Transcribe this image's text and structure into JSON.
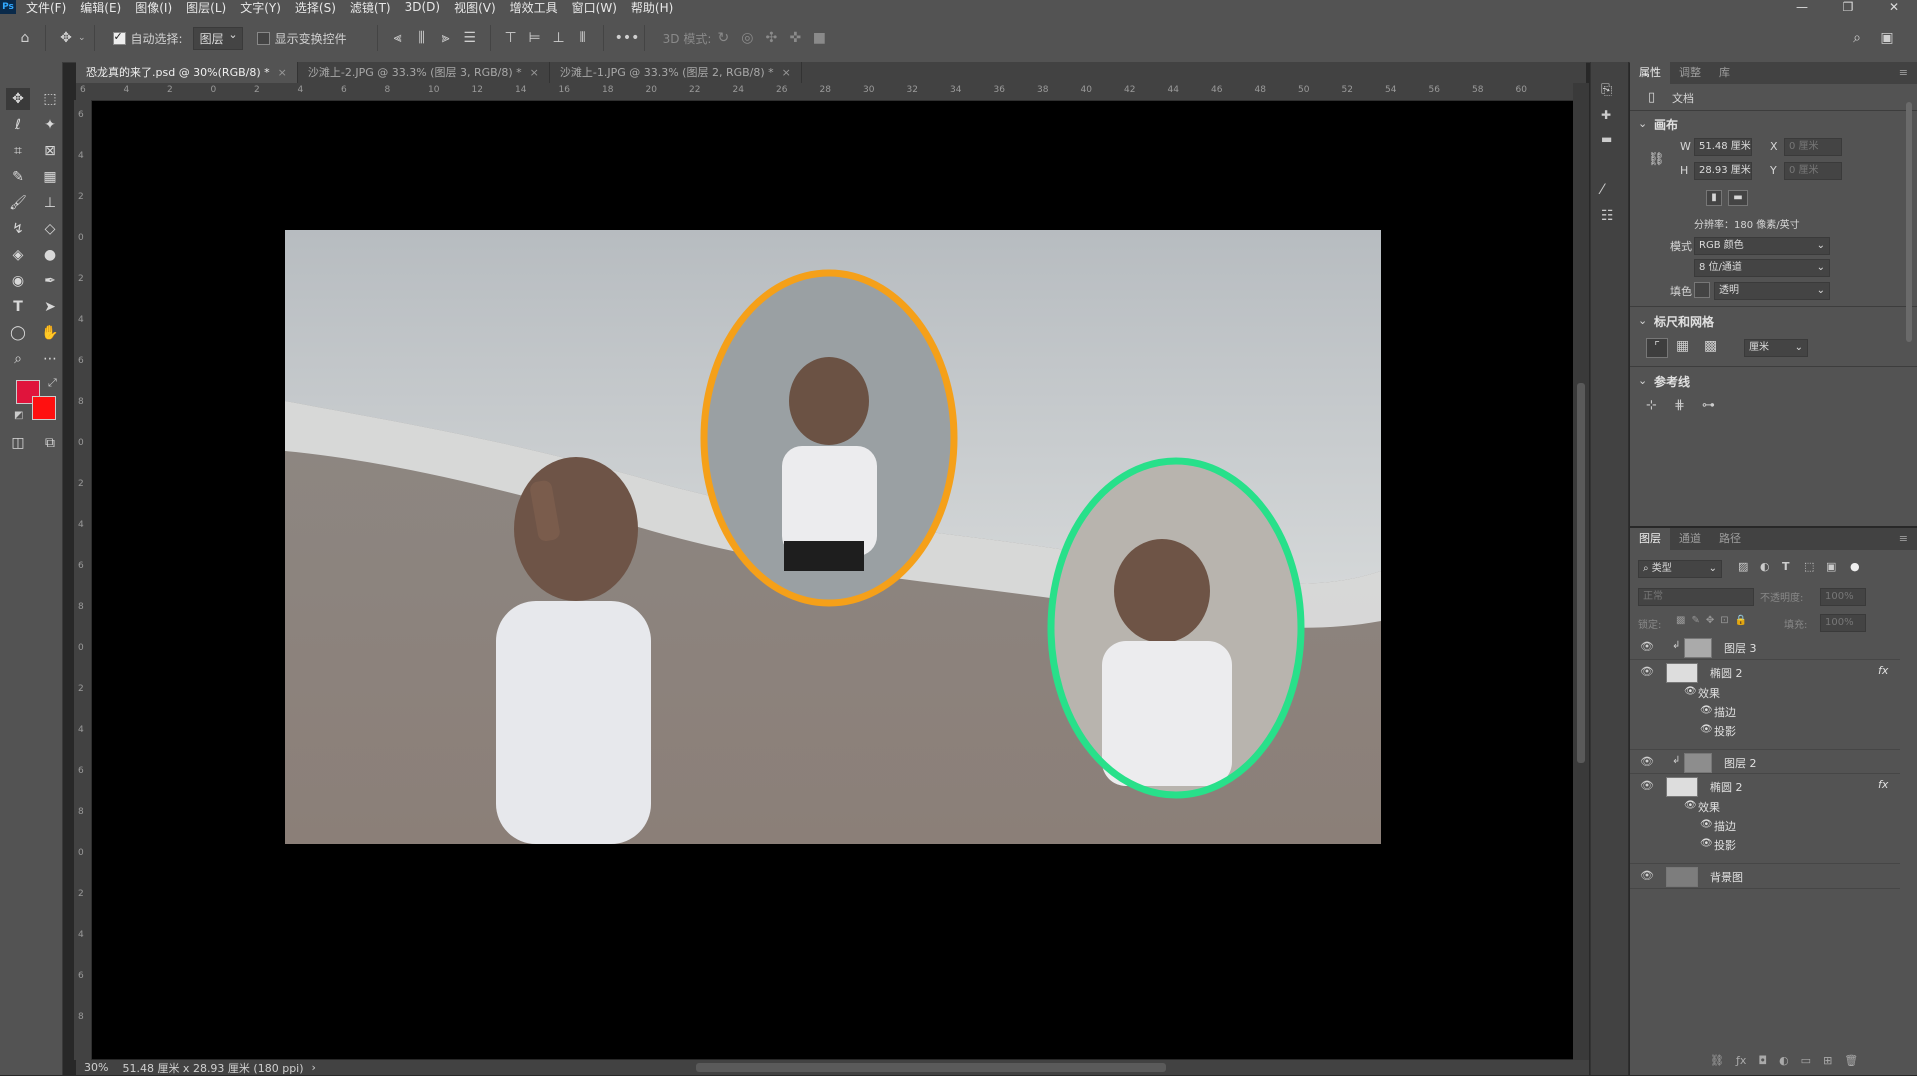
{
  "menu": {
    "logo": "Ps",
    "items": [
      "文件(F)",
      "编辑(E)",
      "图像(I)",
      "图层(L)",
      "文字(Y)",
      "选择(S)",
      "滤镜(T)",
      "3D(D)",
      "视图(V)",
      "增效工具",
      "窗口(W)",
      "帮助(H)"
    ],
    "window_controls": [
      "—",
      "❐",
      "✕"
    ]
  },
  "options": {
    "auto_select_label": "自动选择:",
    "auto_select_value": "图层",
    "show_transform_label": "显示变换控件",
    "mode_3d_label": "3D 模式:",
    "more": "•••"
  },
  "tabs": [
    {
      "label": "恐龙真的来了.psd @ 30%(RGB/8) *",
      "active": true
    },
    {
      "label": "沙滩上-2.JPG @ 33.3% (图层 3, RGB/8) *",
      "active": false
    },
    {
      "label": "沙滩上-1.JPG @ 33.3% (图层 2, RGB/8) *",
      "active": false
    }
  ],
  "ruler": {
    "h_ticks": [
      "6",
      "4",
      "2",
      "0",
      "2",
      "4",
      "6",
      "8",
      "10",
      "12",
      "14",
      "16",
      "18",
      "20",
      "22",
      "24",
      "26",
      "28",
      "30",
      "32",
      "34",
      "36",
      "38",
      "40",
      "42",
      "44",
      "46",
      "48",
      "50",
      "52",
      "54",
      "56",
      "58",
      "60"
    ],
    "v_ticks": [
      "6",
      "4",
      "2",
      "0",
      "2",
      "4",
      "6",
      "8",
      "0",
      "2",
      "4",
      "6",
      "8",
      "0",
      "2",
      "4",
      "6",
      "8",
      "0",
      "2",
      "4",
      "6",
      "8"
    ]
  },
  "status": {
    "zoom": "30%",
    "doc_info": "51.48 厘米 x 28.93 厘米 (180 ppi)",
    "arrow": "›"
  },
  "properties": {
    "tabs": [
      "属性",
      "调整",
      "库"
    ],
    "doc_label": "文档",
    "canvas_title": "画布",
    "w_label": "W",
    "w_value": "51.48 厘米",
    "h_label": "H",
    "h_value": "28.93 厘米",
    "x_label": "X",
    "x_value": "0 厘米",
    "y_label": "Y",
    "y_value": "0 厘米",
    "resolution": "分辨率：180 像素/英寸",
    "mode_label": "模式",
    "mode_value": "RGB 颜色",
    "depth_value": "8 位/通道",
    "fill_label": "填色",
    "fill_value": "透明",
    "rulers_title": "标尺和网格",
    "unit_value": "厘米",
    "guides_title": "参考线"
  },
  "layers": {
    "tabs": [
      "图层",
      "通道",
      "路径"
    ],
    "filter_label": "类型",
    "blend_mode": "正常",
    "opacity_label": "不透明度:",
    "opacity_value": "100%",
    "lock_label": "锁定:",
    "fill_label": "填充:",
    "fill_value": "100%",
    "effects_label": "效果",
    "stroke_label": "描边",
    "shadow_label": "投影",
    "fx": "fx",
    "items": [
      {
        "name": "图层 3"
      },
      {
        "name": "椭圆 2"
      },
      {
        "name": "图层 2"
      },
      {
        "name": "椭圆 2"
      },
      {
        "name": "背景图"
      }
    ]
  },
  "colors": {
    "orange_ring": "#f5a019",
    "green_ring": "#28e08a",
    "foreground": "#e0143c",
    "background": "#ff1010"
  }
}
